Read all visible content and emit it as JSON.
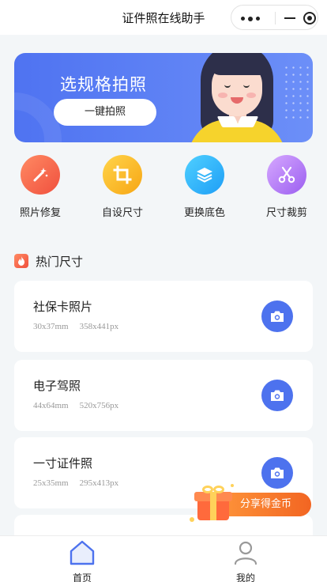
{
  "header": {
    "title": "证件照在线助手"
  },
  "banner": {
    "title": "选规格拍照",
    "button_label": "一键拍照"
  },
  "features": [
    {
      "label": "照片修复",
      "icon": "magic-wand-icon",
      "color": "#f0503e"
    },
    {
      "label": "自设尺寸",
      "icon": "crop-icon",
      "color": "#f7a614"
    },
    {
      "label": "更换底色",
      "icon": "layers-icon",
      "color": "#1e9ef6"
    },
    {
      "label": "尺寸裁剪",
      "icon": "scissors-icon",
      "color": "#9b5ef0"
    }
  ],
  "hot_section": {
    "title": "热门尺寸"
  },
  "cards": [
    {
      "name": "社保卡照片",
      "mm": "30x37mm",
      "px": "358x441px"
    },
    {
      "name": "电子驾照",
      "mm": "44x64mm",
      "px": "520x756px"
    },
    {
      "name": "一寸证件照",
      "mm": "25x35mm",
      "px": "295x413px"
    }
  ],
  "share": {
    "label": "分享得金币"
  },
  "tabbar": {
    "home_label": "首页",
    "mine_label": "我的"
  },
  "colors": {
    "primary": "#4d72ee",
    "accent": "#f26522"
  }
}
